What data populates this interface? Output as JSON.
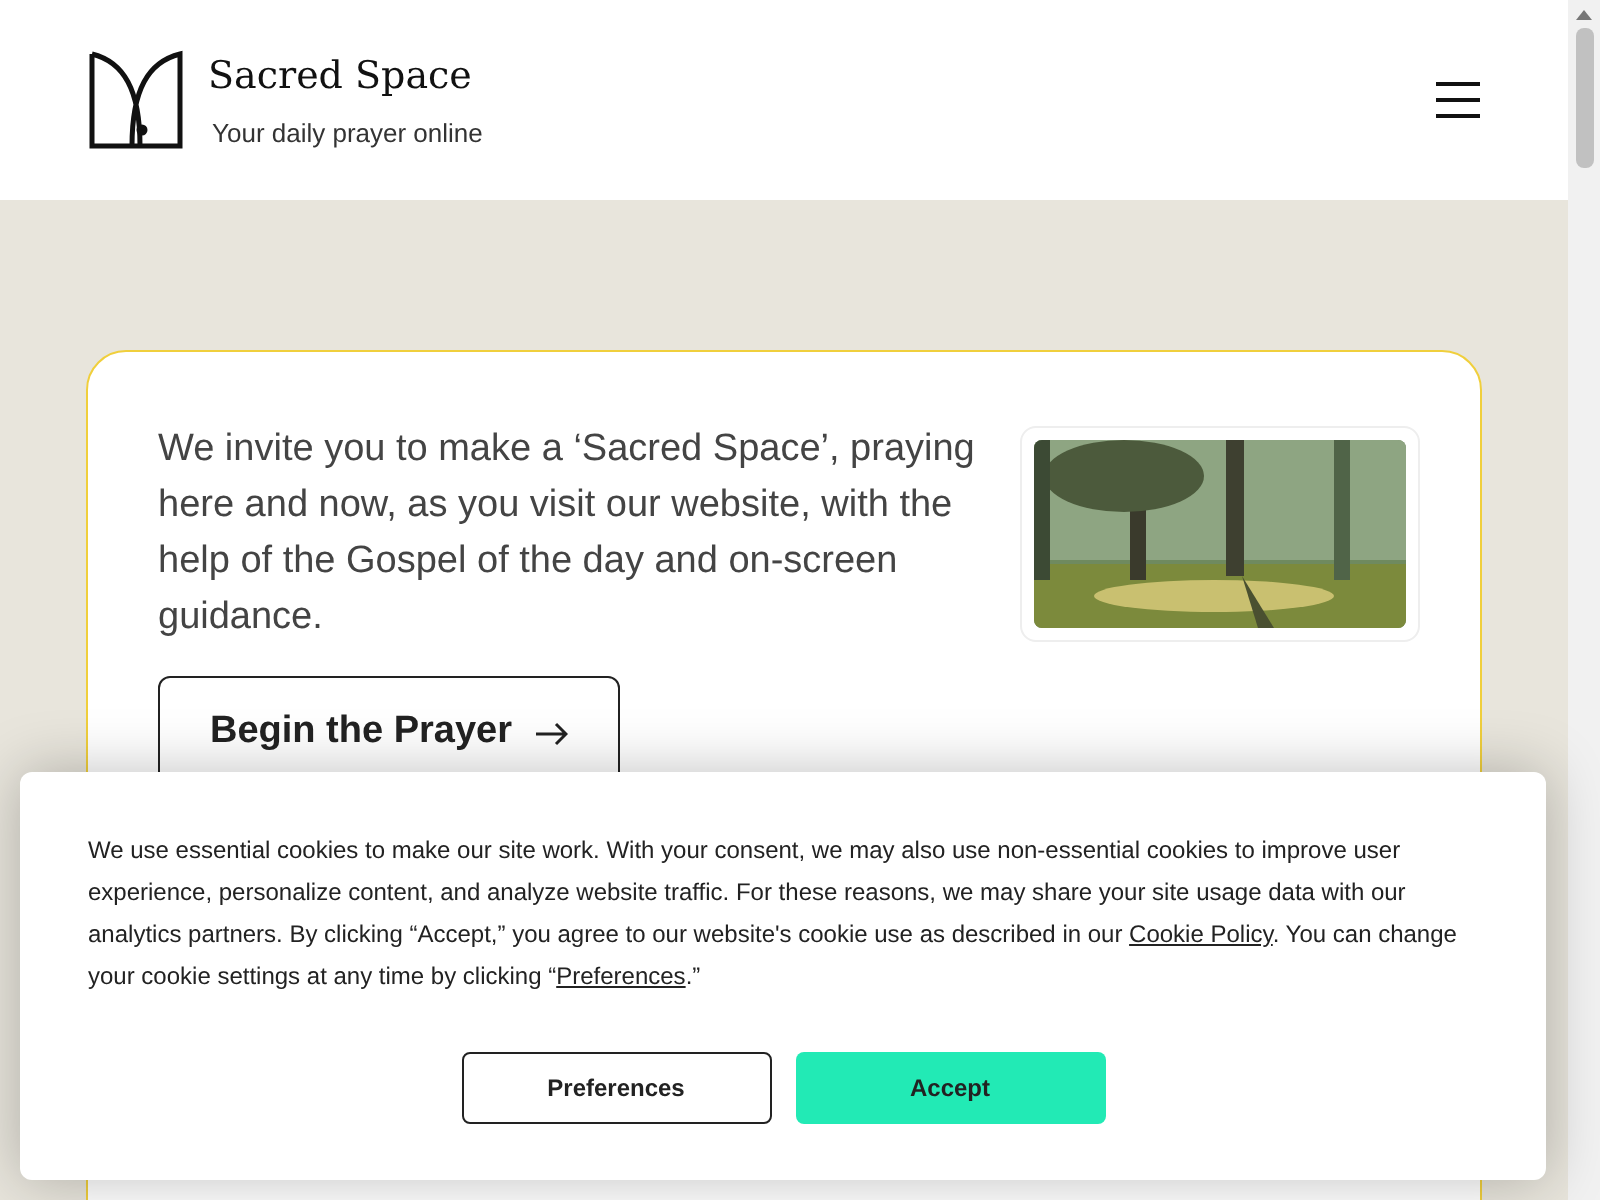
{
  "header": {
    "title": "Sacred Space",
    "tagline": "Your daily prayer online"
  },
  "intro": {
    "text": "We invite you to make a ‘Sacred Space’, praying here and now, as you visit our website, with the help of the Gospel of the day and on-screen guidance.",
    "button": "Begin the Prayer"
  },
  "cookie_banner": {
    "text_before": "We use essential cookies to make our site work. With your consent, we may also use non-essential cookies to improve user experience, personalize content, and analyze website traffic. For these reasons, we may share your site usage data with our analytics partners. By clicking “Accept,” you agree to our website's cookie use as described in our ",
    "policy_link": "Cookie Policy",
    "text_middle": ". You can change your cookie settings at any time by clicking “",
    "preferences_link": "Preferences",
    "text_after": ".”",
    "buttons": [
      {
        "label": "Preferences",
        "kind": "outline"
      },
      {
        "label": "Accept",
        "kind": "primary"
      }
    ]
  }
}
